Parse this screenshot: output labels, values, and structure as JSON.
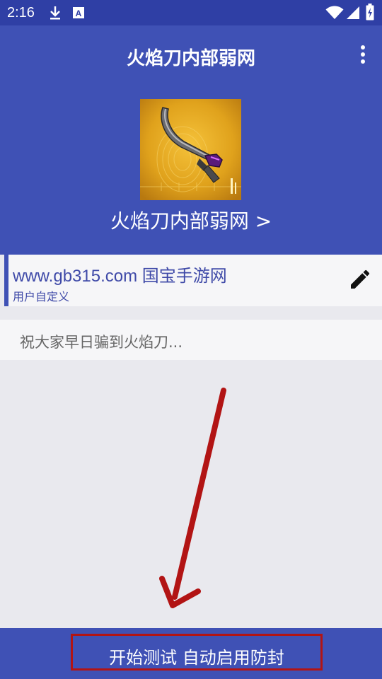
{
  "status_bar": {
    "time": "2:16",
    "icons": [
      "download-icon",
      "a-badge-icon",
      "wifi-icon",
      "signal-icon",
      "battery-charging-icon"
    ]
  },
  "app_bar": {
    "title": "火焰刀内部弱网",
    "menu_icon": "more-vert-icon"
  },
  "profile": {
    "image": "knife-weapon-image",
    "link_text": "火焰刀内部弱网 >"
  },
  "server_card": {
    "title": "www.gb315.com 国宝手游网",
    "subtitle": "用户自定义",
    "edit_icon": "edit-pencil-icon"
  },
  "message_input": {
    "value": "祝大家早日骗到火焰刀..."
  },
  "bottom_action": {
    "label": "开始测试 自动启用防封"
  },
  "colors": {
    "status_bar": "#2f3fa5",
    "primary": "#3f51b5",
    "annotation": "#b21414",
    "background": "#e9e9ee"
  }
}
